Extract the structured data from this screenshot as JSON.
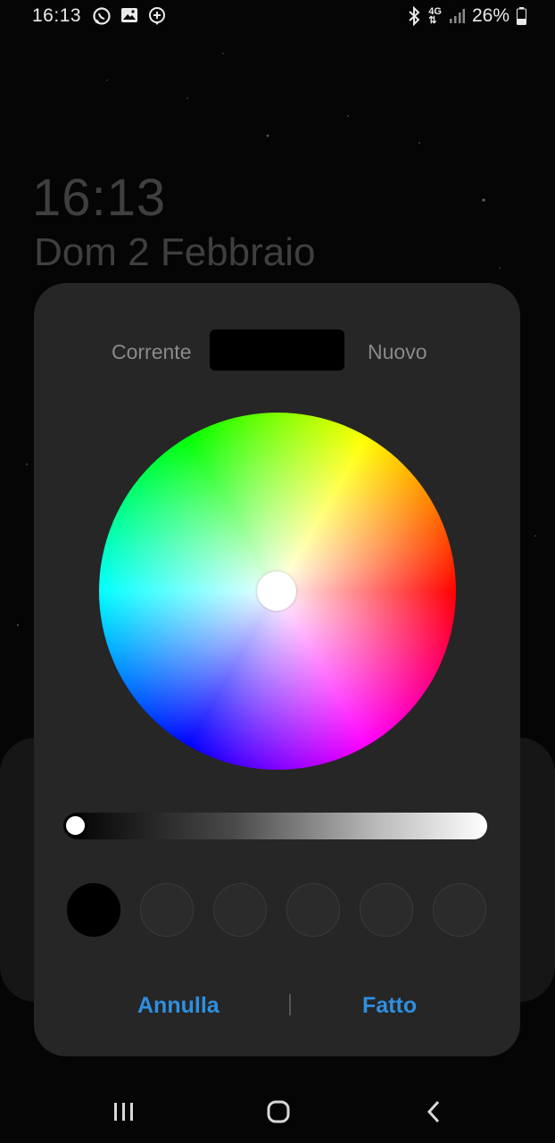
{
  "status_bar": {
    "time": "16:13",
    "left_icons": [
      "whatsapp-icon",
      "gallery-icon",
      "location-pin-icon"
    ],
    "network": "4G",
    "battery": "26%"
  },
  "lock_screen": {
    "time": "16:13",
    "date": "Dom 2 Febbraio"
  },
  "color_picker": {
    "current_label": "Corrente",
    "new_label": "Nuovo",
    "current_color": "#000000",
    "selected_hue_color": "#ffffff",
    "brightness_level": 0,
    "recent_colors": [
      "#000000",
      "",
      "",
      "",
      "",
      ""
    ],
    "cancel_label": "Annulla",
    "done_label": "Fatto",
    "accent_color": "#2f8fe0"
  },
  "nav_bar": {
    "items": [
      "recent-apps-icon",
      "home-icon",
      "back-icon"
    ]
  }
}
